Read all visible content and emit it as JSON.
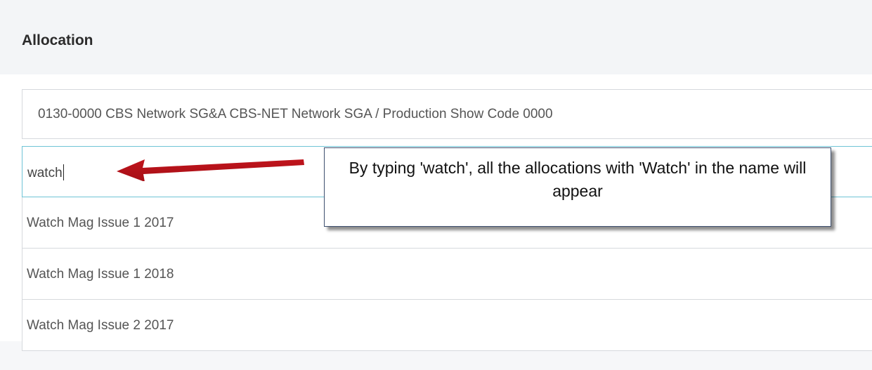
{
  "header": {
    "title": "Allocation"
  },
  "allocation": {
    "selected_value": "0130-0000 CBS Network SG&A CBS-NET Network SGA / Production Show Code 0000",
    "search_value": "watch"
  },
  "dropdown": {
    "options": [
      {
        "label": "Watch Mag Issue 1 2017"
      },
      {
        "label": "Watch Mag Issue 1 2018"
      },
      {
        "label": "Watch Mag Issue 2 2017"
      }
    ]
  },
  "annotation": {
    "text": "By typing 'watch', all the allocations with 'Watch' in the name will appear",
    "arrow_color": "#c0141c"
  }
}
